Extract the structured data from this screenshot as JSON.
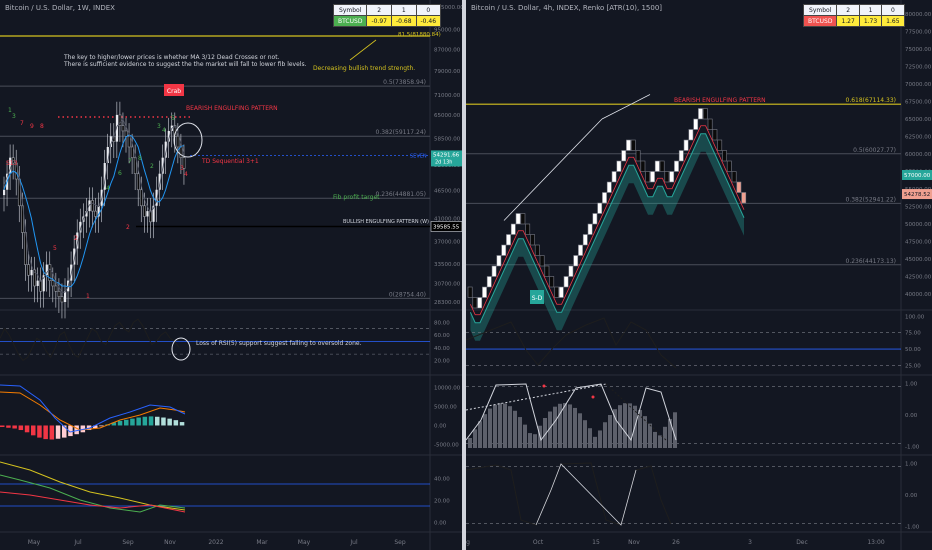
{
  "left": {
    "title": "Bitcoin / U.S. Dollar, 1W, INDEX",
    "table": {
      "headers": [
        "Symbol",
        "2",
        "1",
        "0"
      ],
      "row": [
        "BTCUSD",
        "-0.97",
        "-0.68",
        "-0.46"
      ],
      "row_color": "#4caf50"
    },
    "notes": {
      "line1": "The key to higher/lower prices is whether MA 3/12 Dead Crosses or not.",
      "line2": "There is sufficient evidence to suggest the the market will fall to lower fib levels.",
      "trend": "Decreasing bullish trend strength.",
      "bearish": "BEARISH ENGULFING PATTERN",
      "td": "TD Sequential 3+1",
      "crab": "Crab",
      "fibtarget": "Fib profit target",
      "bullish": "BULLISH ENGULFING PATTERN (W)",
      "rsi": "Loss of RSI(5) support suggest falling to oversold zone.",
      "s13": "S13"
    },
    "fib": [
      "0.5(73858.94)",
      "0.382(59117.24)",
      "0.236(44881.05)",
      "0(28754.40)"
    ],
    "price_label": "54291.66",
    "price_sub": "2d 13h",
    "level_label": "39585.55",
    "xticks": [
      "May",
      "Jul",
      "Sep",
      "Nov",
      "2022",
      "Mar",
      "May",
      "Jul",
      "Sep"
    ]
  },
  "right": {
    "title": "Bitcoin / U.S. Dollar, 4h, INDEX, Renko [ATR(10), 1500]",
    "table": {
      "headers": [
        "Symbol",
        "2",
        "1",
        "0"
      ],
      "row": [
        "BTCUSD",
        "1.27",
        "1.73",
        "1.65"
      ],
      "row_color": "#ef5350"
    },
    "notes": {
      "bearish": "BEARISH ENGULFING PATTERN",
      "sd": "S-D"
    },
    "fib": [
      "0.618(67114.33)",
      "0.5(60027.77)",
      "0.382(52941.22)",
      "0.236(44173.13)"
    ],
    "price_label": "57000.00",
    "price_sub": "54278.52",
    "xticks": [
      "g",
      "Oct",
      "15",
      "Nov",
      "26",
      "3",
      "Dec",
      "13:00"
    ]
  },
  "chart_data": [
    {
      "type": "candlestick",
      "title": "Bitcoin / U.S. Dollar, 1W, INDEX",
      "x": [
        "May",
        "Jul",
        "Sep",
        "Nov",
        "2022",
        "Mar",
        "May",
        "Jul",
        "Sep"
      ],
      "y_ticks": [
        105000,
        95000,
        87000,
        79000,
        71000,
        65000,
        58500,
        52000,
        46500,
        41000,
        37000,
        33500,
        30700,
        28300
      ],
      "last_price": 54291.66,
      "level": 39585.55,
      "fib_levels": {
        "0.5": 73858.94,
        "0.382": 59117.24,
        "0.236": 44881.05,
        "0": 28754.4
      },
      "rsi_ticks": [
        80,
        60,
        40,
        20
      ],
      "macd_ticks": [
        10000,
        5000,
        0,
        -5000
      ],
      "bottom_ticks": [
        40,
        20,
        0
      ]
    },
    {
      "type": "renko",
      "title": "Bitcoin / U.S. Dollar, 4h, INDEX, Renko [ATR(10), 1500]",
      "x": [
        "g",
        "Oct",
        "15",
        "Nov",
        "26",
        "3",
        "Dec",
        "13:00"
      ],
      "y_ticks": [
        80000,
        77500,
        75000,
        72500,
        70000,
        67500,
        65000,
        62500,
        60000,
        57500,
        55000,
        52500,
        50000,
        47500,
        45000,
        42500,
        40000
      ],
      "last_price": 57000.0,
      "fib_levels": {
        "0.618": 67114.33,
        "0.5": 60027.77,
        "0.382": 52941.22,
        "0.236": 44173.13
      },
      "osc1_ticks": [
        100,
        75,
        50,
        25
      ],
      "osc2_ticks": [
        1.0,
        0.0,
        -1.0
      ],
      "osc3_ticks": [
        1.0,
        0.0,
        -1.0
      ]
    }
  ]
}
